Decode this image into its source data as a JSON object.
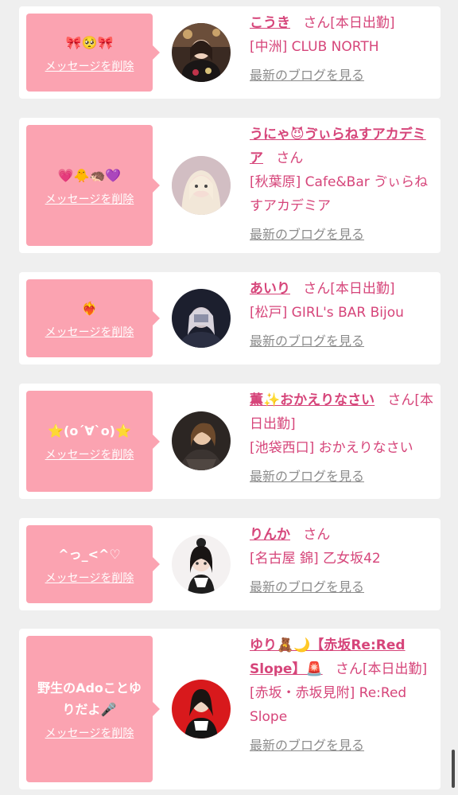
{
  "blog_label": "最新のブログを見る",
  "delete_label": "メッセージを削除",
  "san": "さん",
  "cards": [
    {
      "message": "🎀🥺🎀",
      "name": "こうき",
      "status": "[本日出勤]",
      "shop": "[中洲] CLUB NORTH"
    },
    {
      "message": "💗🐥🦔💜",
      "name": "うにゃ😈ゔぃらねすアカデミア",
      "status": "",
      "shop": "[秋葉原] Cafe&Bar ゔぃらねすアカデミア"
    },
    {
      "message": "❤️‍🔥",
      "name": "あいり",
      "status": "[本日出勤]",
      "shop": "[松戸] GIRL's BAR Bijou"
    },
    {
      "message": "⭐️(o´∀`o)⭐️",
      "name": "薫✨おかえりなさい",
      "status": "[本日出勤]",
      "shop": "[池袋西口] おかえりなさい"
    },
    {
      "message": "^っ_<^♡",
      "name": "りんか",
      "status": "",
      "shop": "[名古屋 錦] 乙女坂42"
    },
    {
      "message": "野生のAdoことゆりだよ🎤",
      "name": "ゆり🧸🌙【赤坂Re:Red Slope】🚨",
      "status": "[本日出勤]",
      "shop": "[赤坂・赤坂見附] Re:Red Slope"
    }
  ]
}
